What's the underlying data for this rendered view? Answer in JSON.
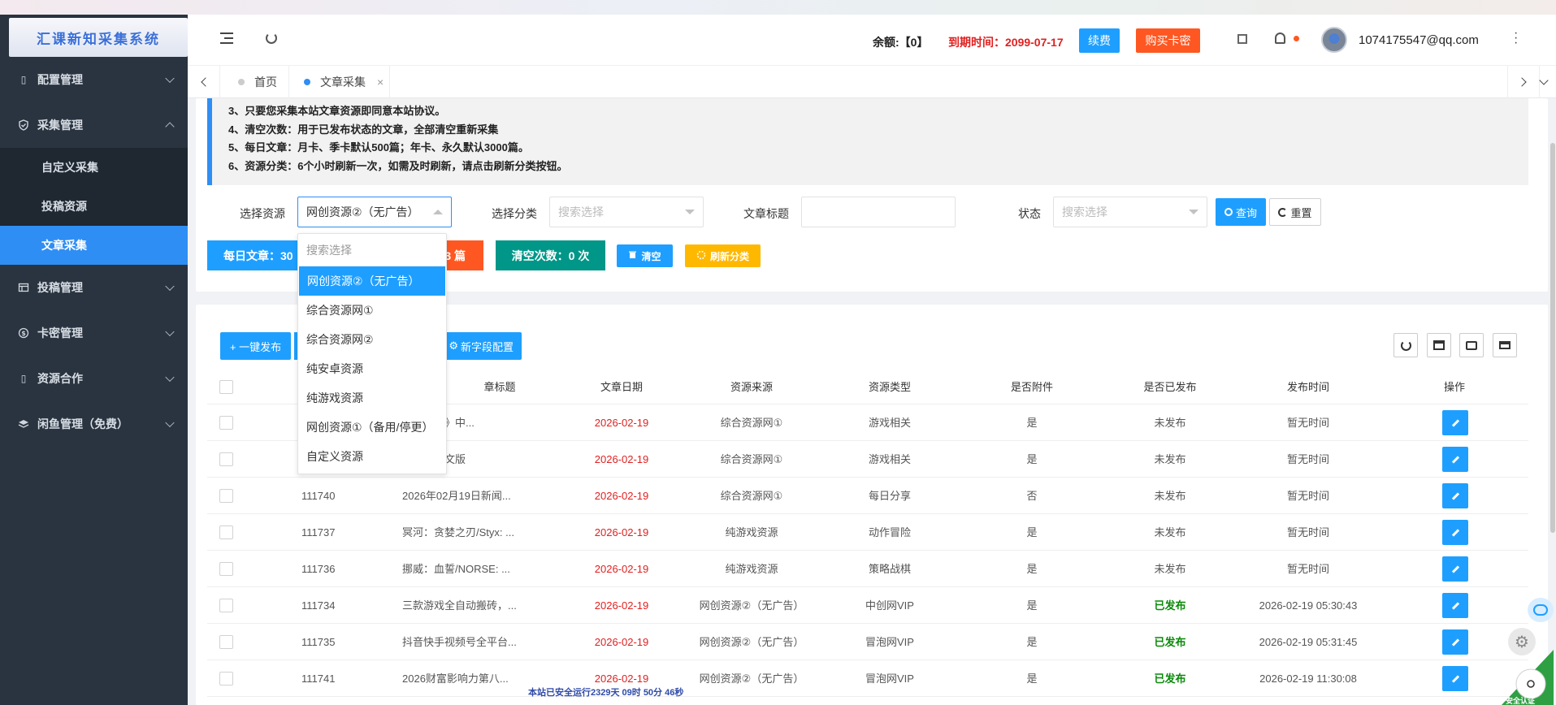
{
  "app": {
    "logo": "汇课新知采集系统"
  },
  "sidebar": {
    "items": [
      {
        "label": "配置管理",
        "icon": "square-icon"
      },
      {
        "label": "采集管理",
        "icon": "shield-check-icon",
        "expanded": true
      },
      {
        "label": "投稿管理",
        "icon": "table-icon"
      },
      {
        "label": "卡密管理",
        "icon": "dollar-icon"
      },
      {
        "label": "资源合作",
        "icon": "square-icon"
      },
      {
        "label": "闲鱼管理（免费）",
        "icon": "layers-icon"
      }
    ],
    "sub_items": [
      "自定义采集",
      "投稿资源",
      "文章采集"
    ]
  },
  "header": {
    "balance": "余额:【0】",
    "expire": "到期时间：2099-07-17",
    "renew": "续费",
    "buy_card": "购买卡密",
    "user": "1074175547@qq.com"
  },
  "tabs": {
    "home": "首页",
    "article": "文章采集",
    "close": "×"
  },
  "notice": [
    "3、只要您采集本站文章资源即同意本站协议。",
    "4、清空次数：用于已发布状态的文章，全部清空重新采集",
    "5、每日文章：月卡、季卡默认500篇；年卡、永久默认3000篇。",
    "6、资源分类：6个小时刷新一次，如需及时刷新，请点击刷新分类按钮。"
  ],
  "filters": {
    "source_label": "选择资源",
    "source_value": "网创资源②（无广告）",
    "category_label": "选择分类",
    "category_placeholder": "搜索选择",
    "title_label": "文章标题",
    "status_label": "状态",
    "status_placeholder": "搜索选择",
    "query": "查询",
    "reset": "重置"
  },
  "stats": {
    "daily": "每日文章：30",
    "remain_suffix": "3 篇",
    "clear_count": "清空次数：0 次",
    "clear_btn": "清空",
    "refresh_btn": "刷新分类"
  },
  "dropdown": {
    "search_placeholder": "搜索选择",
    "options": [
      "网创资源②（无广告）",
      "综合资源网①",
      "综合资源网②",
      "纯安卓资源",
      "纯游戏资源",
      "网创资源①（备用/停更）",
      "自定义资源"
    ],
    "selected_index": 0
  },
  "toolbar": {
    "publish": "+ 一键发布",
    "new_field": "新字段配置"
  },
  "table": {
    "headers": {
      "title": "章标题",
      "date": "文章日期",
      "source": "资源来源",
      "type": "资源类型",
      "attach": "是否附件",
      "published": "是否已发布",
      "pubtime": "发布时间",
      "ops": "操作"
    },
    "rows": [
      {
        "id": "",
        "title": "告模拟器》中...",
        "date": "2026-02-19",
        "source": "综合资源网①",
        "type": "游戏相关",
        "attach": "是",
        "published": "未发布",
        "pubtime": "暂无时间"
      },
      {
        "id": "",
        "title": "脚印》中文版",
        "date": "2026-02-19",
        "source": "综合资源网①",
        "type": "游戏相关",
        "attach": "是",
        "published": "未发布",
        "pubtime": "暂无时间"
      },
      {
        "id": "111740",
        "title": "2026年02月19日新闻...",
        "date": "2026-02-19",
        "source": "综合资源网①",
        "type": "每日分享",
        "attach": "否",
        "published": "未发布",
        "pubtime": "暂无时间"
      },
      {
        "id": "111737",
        "title": "冥河：贪婪之刃/Styx: ...",
        "date": "2026-02-19",
        "source": "纯游戏资源",
        "type": "动作冒险",
        "attach": "是",
        "published": "未发布",
        "pubtime": "暂无时间"
      },
      {
        "id": "111736",
        "title": "挪威：血誓/NORSE: ...",
        "date": "2026-02-19",
        "source": "纯游戏资源",
        "type": "策略战棋",
        "attach": "是",
        "published": "未发布",
        "pubtime": "暂无时间"
      },
      {
        "id": "111734",
        "title": "三款游戏全自动搬砖，...",
        "date": "2026-02-19",
        "source": "网创资源②（无广告）",
        "type": "中创网VIP",
        "attach": "是",
        "published": "已发布",
        "pubtime": "2026-02-19 05:30:43"
      },
      {
        "id": "111735",
        "title": "抖音快手视频号全平台...",
        "date": "2026-02-19",
        "source": "网创资源②（无广告）",
        "type": "冒泡网VIP",
        "attach": "是",
        "published": "已发布",
        "pubtime": "2026-02-19 05:31:45"
      },
      {
        "id": "111741",
        "title": "2026财富影响力第八...",
        "date": "2026-02-19",
        "source": "网创资源②（无广告）",
        "type": "冒泡网VIP",
        "attach": "是",
        "published": "已发布",
        "pubtime": "2026-02-19 11:30:08"
      }
    ]
  },
  "footer": {
    "runtime": "本站已安全运行2329天 09时 50分 46秒",
    "cert": "安全认证"
  },
  "colors": {
    "primary": "#1e9fff",
    "danger": "#ff5722",
    "teal": "#009688",
    "warn": "#ffb800",
    "sidebar": "#2a3440"
  }
}
